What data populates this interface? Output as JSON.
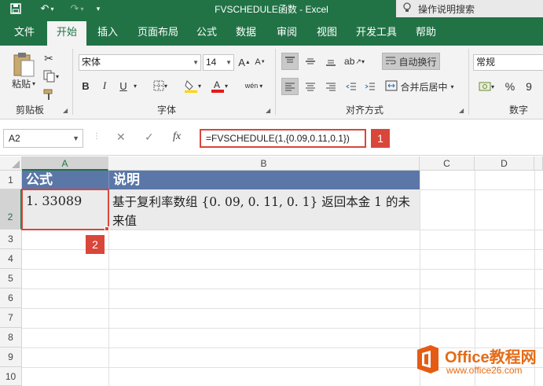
{
  "titlebar": {
    "title": "FVSCHEDULE函数  -  Excel",
    "tell_me": "操作说明搜索"
  },
  "tabs": [
    "文件",
    "开始",
    "插入",
    "页面布局",
    "公式",
    "数据",
    "审阅",
    "视图",
    "开发工具",
    "帮助"
  ],
  "ribbon": {
    "clipboard": {
      "paste": "粘贴",
      "label": "剪贴板"
    },
    "font": {
      "name": "宋体",
      "size": "14",
      "bold": "B",
      "italic": "I",
      "underline": "U",
      "grow": "A",
      "shrink": "A",
      "wen": "wén",
      "label": "字体"
    },
    "align": {
      "wrap": "自动换行",
      "merge": "合并后居中",
      "label": "对齐方式"
    },
    "number": {
      "format": "常规",
      "percent": "%",
      "comma": "9",
      "label": "数字"
    }
  },
  "formula_bar": {
    "name_box": "A2",
    "cancel": "✕",
    "enter": "✓",
    "fx": "fx",
    "formula": "=FVSCHEDULE(1,{0.09,0.11,0.1})"
  },
  "callouts": {
    "one": "1",
    "two": "2"
  },
  "sheet": {
    "columns": [
      "A",
      "B",
      "C",
      "D"
    ],
    "rows": [
      "1",
      "2",
      "3",
      "4",
      "5",
      "6",
      "7",
      "8",
      "9",
      "10"
    ],
    "header_row": [
      "公式",
      "说明"
    ],
    "a2": "1. 33089",
    "b2": "基于复利率数组 {0. 09, 0. 11, 0. 1} 返回本金 1 的未来值"
  },
  "colors": {
    "excel_green": "#217346",
    "header_fill": "#5a77a8",
    "callout_red": "#d9463a"
  },
  "watermark": {
    "brand": "Office教程网",
    "url": "www.office26.com"
  }
}
